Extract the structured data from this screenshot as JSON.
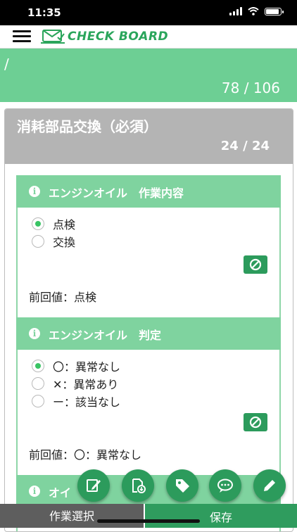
{
  "status_bar": {
    "time": "11:35"
  },
  "header": {
    "logo_text": "CHECK BOARD",
    "brand_color": "#2aa55b"
  },
  "banner": {
    "path": "/",
    "count": "78 / 106"
  },
  "category": {
    "title": "消耗部品交換（必須）",
    "count": "24 / 24"
  },
  "items": [
    {
      "title": "エンジンオイル　作業内容",
      "options": [
        {
          "label": "点検",
          "checked": true
        },
        {
          "label": "交換",
          "checked": false
        }
      ],
      "previous": "前回値：点検"
    },
    {
      "title": "エンジンオイル　判定",
      "options": [
        {
          "label": "〇：異常なし",
          "checked": true
        },
        {
          "label": "✕：異常あり",
          "checked": false
        },
        {
          "label": "ー：該当なし",
          "checked": false
        }
      ],
      "previous": "前回値：〇：異常なし"
    },
    {
      "title": "オイ"
    }
  ],
  "fabs": [
    "note-edit-icon",
    "download-doc-icon",
    "tag-icon",
    "chat-icon",
    "pencil-icon"
  ],
  "bottom_bar": {
    "left_label": "作業選択",
    "right_label": "保存"
  },
  "colors": {
    "banner": "#6dcf94",
    "item_header": "#7fd39f",
    "action_green": "#2c9b5c",
    "selected_radio": "#39c464"
  }
}
